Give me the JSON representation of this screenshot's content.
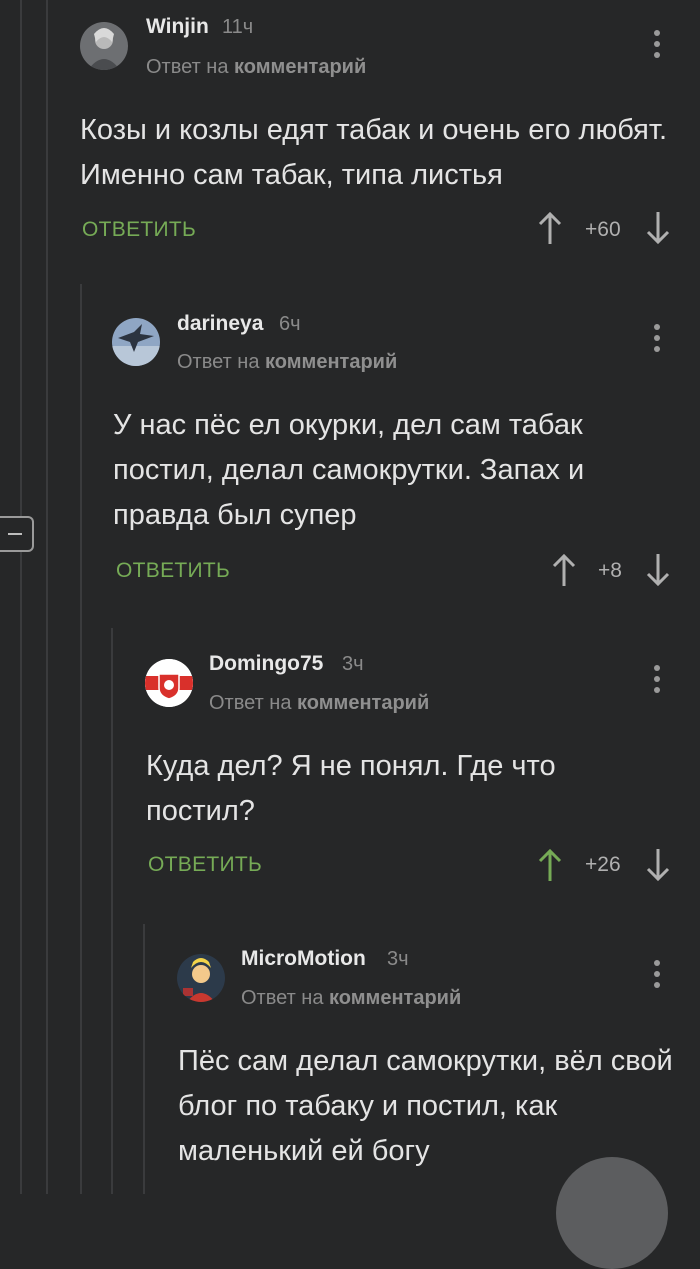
{
  "comments": [
    {
      "username": "Winjin",
      "time": "11ч",
      "reply_prefix": "Ответ на",
      "reply_target": "комментарий",
      "body": "Козы и козлы едят табак и очень его любят. Именно сам табак, типа листья",
      "reply_label": "ОТВЕТИТЬ",
      "rating": "+60",
      "upvoted": false
    },
    {
      "username": "darineya",
      "time": "6ч",
      "reply_prefix": "Ответ на",
      "reply_target": "комментарий",
      "body": "У нас пёс ел окурки, дел сам табак постил, делал самокрутки. Запах и правда был супер",
      "reply_label": "ОТВЕТИТЬ",
      "rating": "+8",
      "upvoted": false
    },
    {
      "username": "Domingo75",
      "time": "3ч",
      "reply_prefix": "Ответ на",
      "reply_target": "комментарий",
      "body": "Куда дел? Я не понял. Где что постил?",
      "reply_label": "ОТВЕТИТЬ",
      "rating": "+26",
      "upvoted": true
    },
    {
      "username": "MicroMotion",
      "time": "3ч",
      "reply_prefix": "Ответ на",
      "reply_target": "комментарий",
      "body": "Пёс сам делал самокрутки, вёл свой блог по табаку и постил, как маленький ей богу"
    }
  ],
  "colors": {
    "background": "#262728",
    "accent_green": "#76ab56",
    "muted": "#8a8a8a"
  }
}
